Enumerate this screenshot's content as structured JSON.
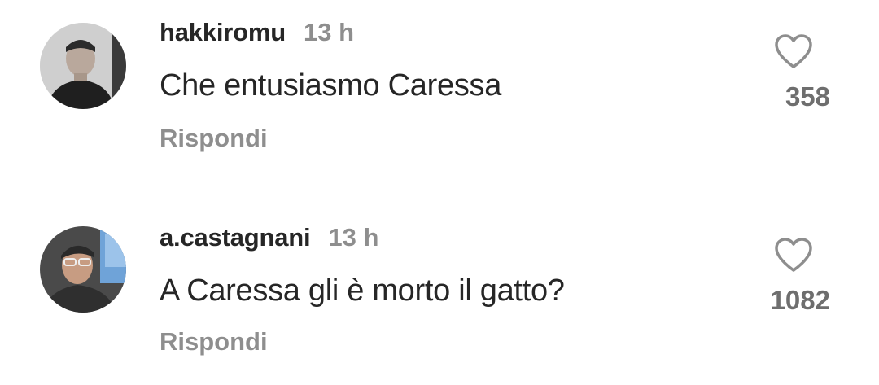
{
  "comments": [
    {
      "username": "hakkiromu",
      "time": "13 h",
      "text": "Che entusiasmo Caressa",
      "reply_label": "Rispondi",
      "likes": "358",
      "avatar_icon": "user-avatar"
    },
    {
      "username": "a.castagnani",
      "time": "13 h",
      "text": "A Caressa gli è morto il gatto?",
      "reply_label": "Rispondi",
      "likes": "1082",
      "avatar_icon": "user-avatar"
    }
  ],
  "colors": {
    "username": "#262626",
    "secondary": "#8e8e8e",
    "text": "#262626",
    "like_count": "#6e6e6e",
    "heart_outline": "#8e8e8e"
  }
}
